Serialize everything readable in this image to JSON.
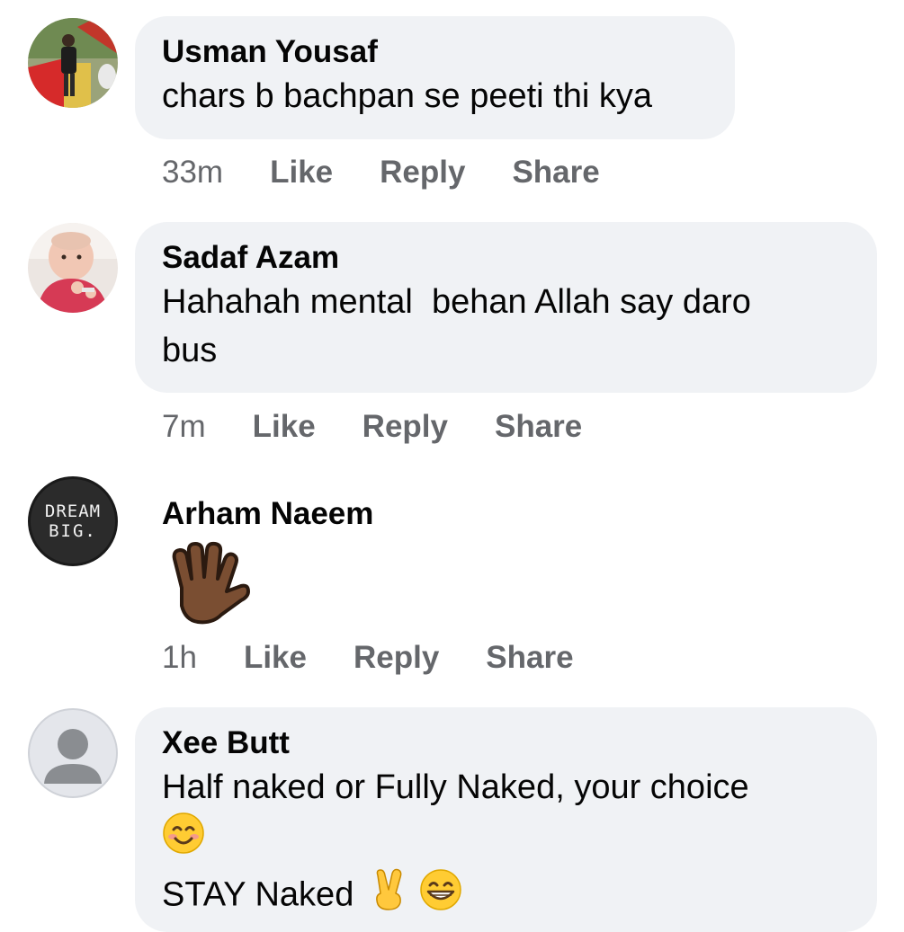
{
  "comments": [
    {
      "author": "Usman Yousaf",
      "text": "chars b bachpan se peeti thi kya",
      "time": "33m",
      "like": "Like",
      "reply": "Reply",
      "share": "Share",
      "avatar_icon": "photo-avatar-person-outdoors"
    },
    {
      "author": "Sadaf Azam",
      "text_line1": "Hahahah mental  behan Allah say daro",
      "text_line2": "bus",
      "time": "7m",
      "like": "Like",
      "reply": "Reply",
      "share": "Share",
      "avatar_icon": "photo-avatar-baby"
    },
    {
      "author": "Arham Naeem",
      "emoji": "raised-hand-medium-dark-skin-emoji",
      "time": "1h",
      "like": "Like",
      "reply": "Reply",
      "share": "Share",
      "avatar_text_line1": "DREAM",
      "avatar_text_line2": "BIG."
    },
    {
      "author": "Xee Butt",
      "text_line1": "Half naked or Fully Naked, your choice",
      "text_line3": "STAY Naked",
      "emojis": [
        "smiling-face-emoji",
        "victory-hand-emoji",
        "grinning-face-emoji"
      ],
      "avatar_icon": "default-user-avatar"
    }
  ],
  "colors": {
    "bubble": "#f0f2f5",
    "meta_text": "#65676b",
    "body_text": "#050505"
  }
}
